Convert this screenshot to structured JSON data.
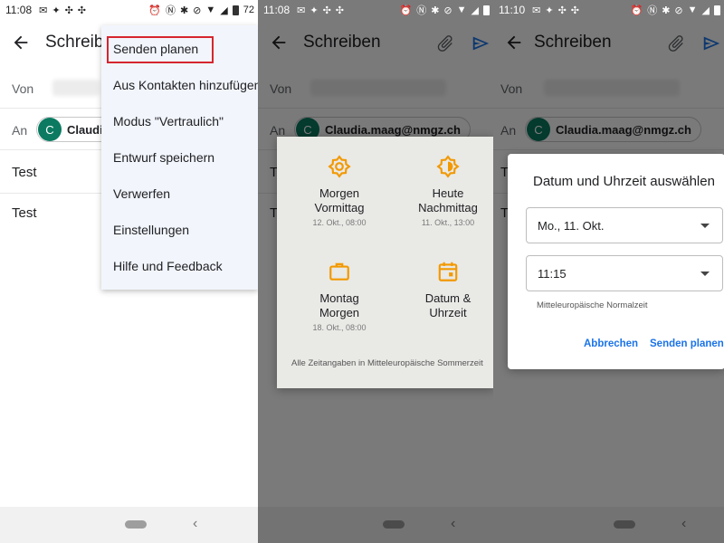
{
  "status": {
    "panel1": {
      "time": "11:08",
      "battery": "72"
    },
    "panel2": {
      "time": "11:08"
    },
    "panel3": {
      "time": "11:10"
    }
  },
  "compose": {
    "title": "Schreiben",
    "title_truncated": "Schreib",
    "from_label": "Von",
    "to_label": "An",
    "recipient_initial": "C",
    "recipient_email": "Claudia.maag@nmgz.ch",
    "recipient_truncated": "Claudia",
    "subject": "Test",
    "body": "Test"
  },
  "menu": {
    "items": [
      "Senden planen",
      "Aus Kontakten hinzufügen",
      "Modus \"Vertraulich\"",
      "Entwurf speichern",
      "Verwerfen",
      "Einstellungen",
      "Hilfe und Feedback"
    ]
  },
  "schedule": {
    "options": [
      {
        "line1": "Morgen",
        "line2": "Vormittag",
        "sub": "12. Okt., 08:00",
        "icon": "sun-icon"
      },
      {
        "line1": "Heute",
        "line2": "Nachmittag",
        "sub": "11. Okt., 13:00",
        "icon": "half-sun-icon"
      },
      {
        "line1": "Montag",
        "line2": "Morgen",
        "sub": "18. Okt., 08:00",
        "icon": "briefcase-icon"
      },
      {
        "line1": "Datum &",
        "line2": "Uhrzeit",
        "sub": "",
        "icon": "calendar-icon"
      }
    ],
    "footer": "Alle Zeitangaben in Mitteleuropäische Sommerzeit"
  },
  "datetime": {
    "title": "Datum und Uhrzeit auswählen",
    "date": "Mo., 11. Okt.",
    "time": "11:15",
    "timezone": "Mitteleuropäische Normalzeit",
    "cancel": "Abbrechen",
    "confirm": "Senden planen"
  },
  "colors": {
    "accent_orange": "#f29900",
    "send_blue": "#1a73e8",
    "avatar_green": "#0b7a61",
    "highlight_red": "#d6252e"
  }
}
